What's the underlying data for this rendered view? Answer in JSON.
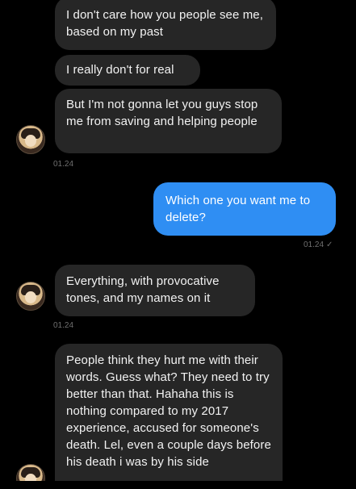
{
  "messages": [
    {
      "id": "m1",
      "direction": "in",
      "text": "I don't care how you people see me, based on my past"
    },
    {
      "id": "m2",
      "direction": "in",
      "text": "I really don't for real"
    },
    {
      "id": "m3",
      "direction": "in",
      "text": "But I'm not gonna let you guys stop me from saving and helping people"
    },
    {
      "id": "m4",
      "direction": "out",
      "text": "Which one you want me to delete?"
    },
    {
      "id": "m5",
      "direction": "in",
      "text": "Everything, with provocative tones, and my names on it"
    },
    {
      "id": "m6",
      "direction": "in",
      "text": "People think they hurt me with their words. Guess what? They need to try better than that. Hahaha this is nothing compared to my 2017 experience, accused for someone's death. Lel, even a couple days before his death i was by his side"
    }
  ],
  "timestamps": {
    "t1": "01.24",
    "t2": "01.24",
    "t3": "01.24"
  },
  "read_check": "✓",
  "colors": {
    "background": "#000000",
    "incoming_bubble": "#262626",
    "outgoing_bubble": "#2f8ef3",
    "timestamp": "#6f6f6f"
  },
  "icons": {
    "contact_avatar": "avatar-icon",
    "read_receipt": "check-icon"
  }
}
